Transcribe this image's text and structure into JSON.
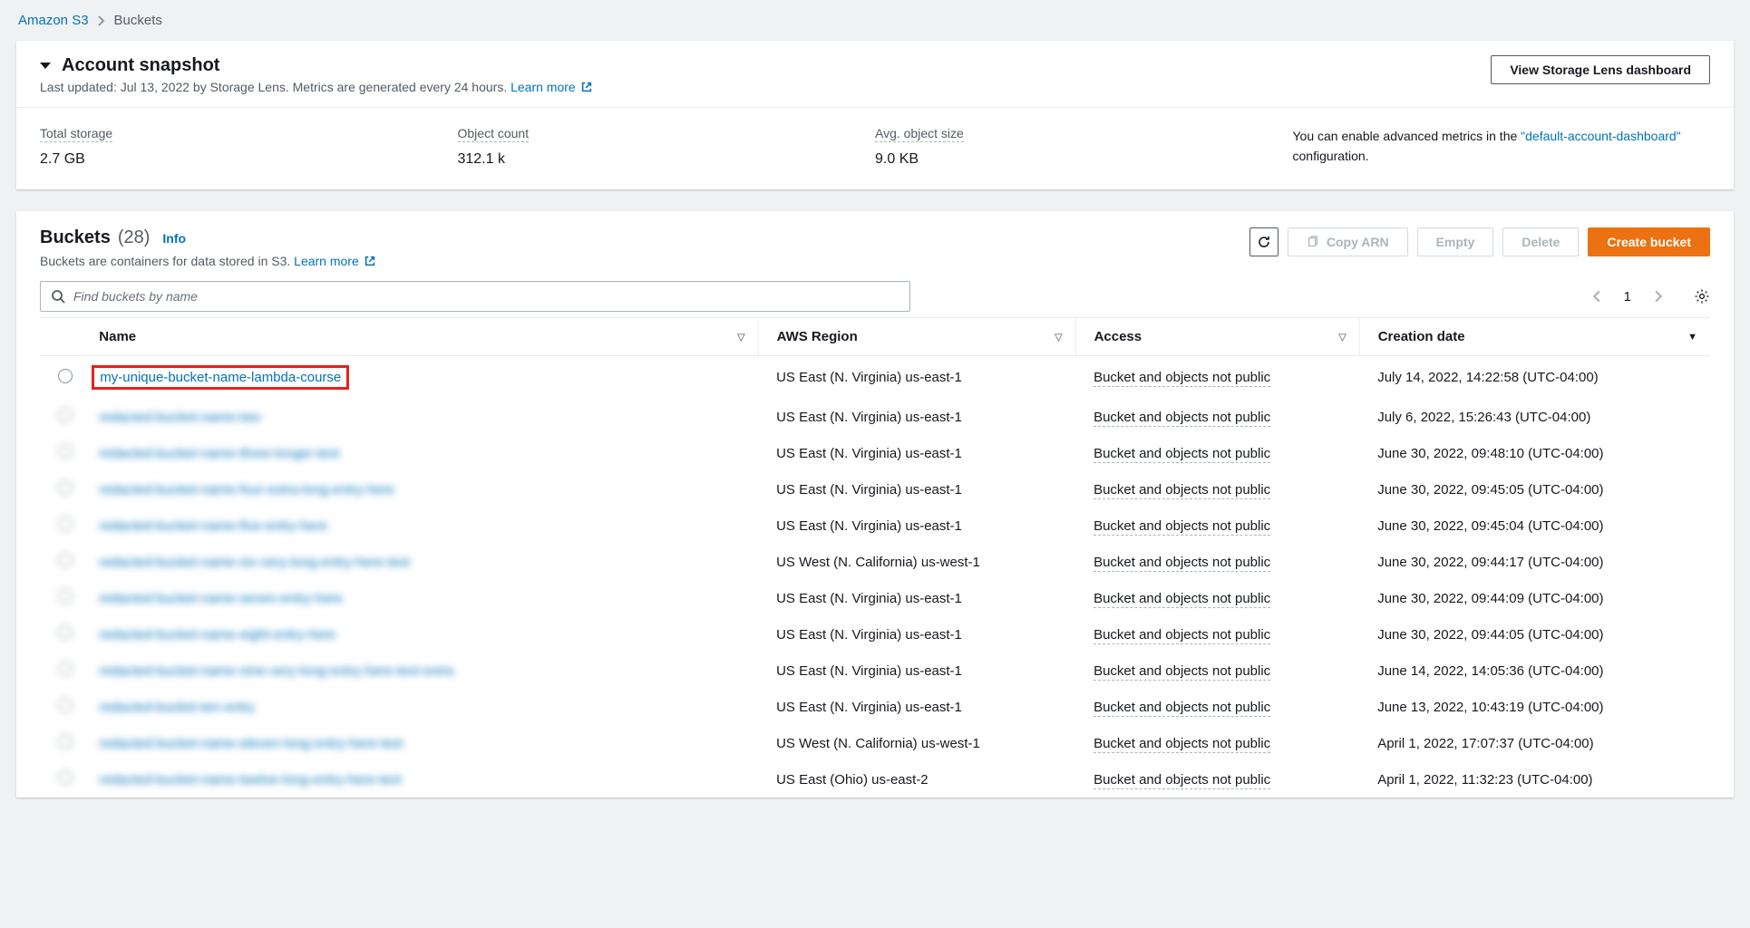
{
  "breadcrumb": {
    "root": "Amazon S3",
    "current": "Buckets"
  },
  "snapshot": {
    "title": "Account snapshot",
    "subtitle_prefix": "Last updated: Jul 13, 2022 by Storage Lens. Metrics are generated every 24 hours. ",
    "learn_more": "Learn more",
    "dashboard_btn": "View Storage Lens dashboard",
    "metrics": {
      "total_storage_label": "Total storage",
      "total_storage_value": "2.7 GB",
      "object_count_label": "Object count",
      "object_count_value": "312.1 k",
      "avg_size_label": "Avg. object size",
      "avg_size_value": "9.0 KB"
    },
    "adv_note_prefix": "You can enable advanced metrics in the ",
    "adv_note_link": "\"default-account-dashboard\"",
    "adv_note_suffix": " configuration."
  },
  "buckets": {
    "title": "Buckets",
    "count": "(28)",
    "info": "Info",
    "subtitle": "Buckets are containers for data stored in S3. ",
    "learn_more": "Learn more",
    "actions": {
      "refresh": "Refresh",
      "copy_arn": "Copy ARN",
      "empty": "Empty",
      "delete": "Delete",
      "create": "Create bucket"
    },
    "search_placeholder": "Find buckets by name",
    "page": "1",
    "columns": {
      "name": "Name",
      "region": "AWS Region",
      "access": "Access",
      "date": "Creation date"
    },
    "rows": [
      {
        "name": "my-unique-bucket-name-lambda-course",
        "region": "US East (N. Virginia) us-east-1",
        "access": "Bucket and objects not public",
        "date": "July 14, 2022, 14:22:58 (UTC-04:00)",
        "highlight": true,
        "blur": false
      },
      {
        "name": "redacted-bucket-name-two",
        "region": "US East (N. Virginia) us-east-1",
        "access": "Bucket and objects not public",
        "date": "July 6, 2022, 15:26:43 (UTC-04:00)",
        "highlight": false,
        "blur": true
      },
      {
        "name": "redacted-bucket-name-three-longer-text",
        "region": "US East (N. Virginia) us-east-1",
        "access": "Bucket and objects not public",
        "date": "June 30, 2022, 09:48:10 (UTC-04:00)",
        "highlight": false,
        "blur": true
      },
      {
        "name": "redacted-bucket-name-four-extra-long-entry-here",
        "region": "US East (N. Virginia) us-east-1",
        "access": "Bucket and objects not public",
        "date": "June 30, 2022, 09:45:05 (UTC-04:00)",
        "highlight": false,
        "blur": true
      },
      {
        "name": "redacted-bucket-name-five-entry-here",
        "region": "US East (N. Virginia) us-east-1",
        "access": "Bucket and objects not public",
        "date": "June 30, 2022, 09:45:04 (UTC-04:00)",
        "highlight": false,
        "blur": true
      },
      {
        "name": "redacted-bucket-name-six-very-long-entry-here-text",
        "region": "US West (N. California) us-west-1",
        "access": "Bucket and objects not public",
        "date": "June 30, 2022, 09:44:17 (UTC-04:00)",
        "highlight": false,
        "blur": true
      },
      {
        "name": "redacted-bucket-name-seven-entry-here",
        "region": "US East (N. Virginia) us-east-1",
        "access": "Bucket and objects not public",
        "date": "June 30, 2022, 09:44:09 (UTC-04:00)",
        "highlight": false,
        "blur": true
      },
      {
        "name": "redacted-bucket-name-eight-entry-here",
        "region": "US East (N. Virginia) us-east-1",
        "access": "Bucket and objects not public",
        "date": "June 30, 2022, 09:44:05 (UTC-04:00)",
        "highlight": false,
        "blur": true
      },
      {
        "name": "redacted-bucket-name-nine-very-long-entry-here-text-extra",
        "region": "US East (N. Virginia) us-east-1",
        "access": "Bucket and objects not public",
        "date": "June 14, 2022, 14:05:36 (UTC-04:00)",
        "highlight": false,
        "blur": true
      },
      {
        "name": "redacted-bucket-ten-entry",
        "region": "US East (N. Virginia) us-east-1",
        "access": "Bucket and objects not public",
        "date": "June 13, 2022, 10:43:19 (UTC-04:00)",
        "highlight": false,
        "blur": true
      },
      {
        "name": "redacted-bucket-name-eleven-long-entry-here-text",
        "region": "US West (N. California) us-west-1",
        "access": "Bucket and objects not public",
        "date": "April 1, 2022, 17:07:37 (UTC-04:00)",
        "highlight": false,
        "blur": true
      },
      {
        "name": "redacted-bucket-name-twelve-long-entry-here-text",
        "region": "US East (Ohio) us-east-2",
        "access": "Bucket and objects not public",
        "date": "April 1, 2022, 11:32:23 (UTC-04:00)",
        "highlight": false,
        "blur": true
      }
    ]
  }
}
